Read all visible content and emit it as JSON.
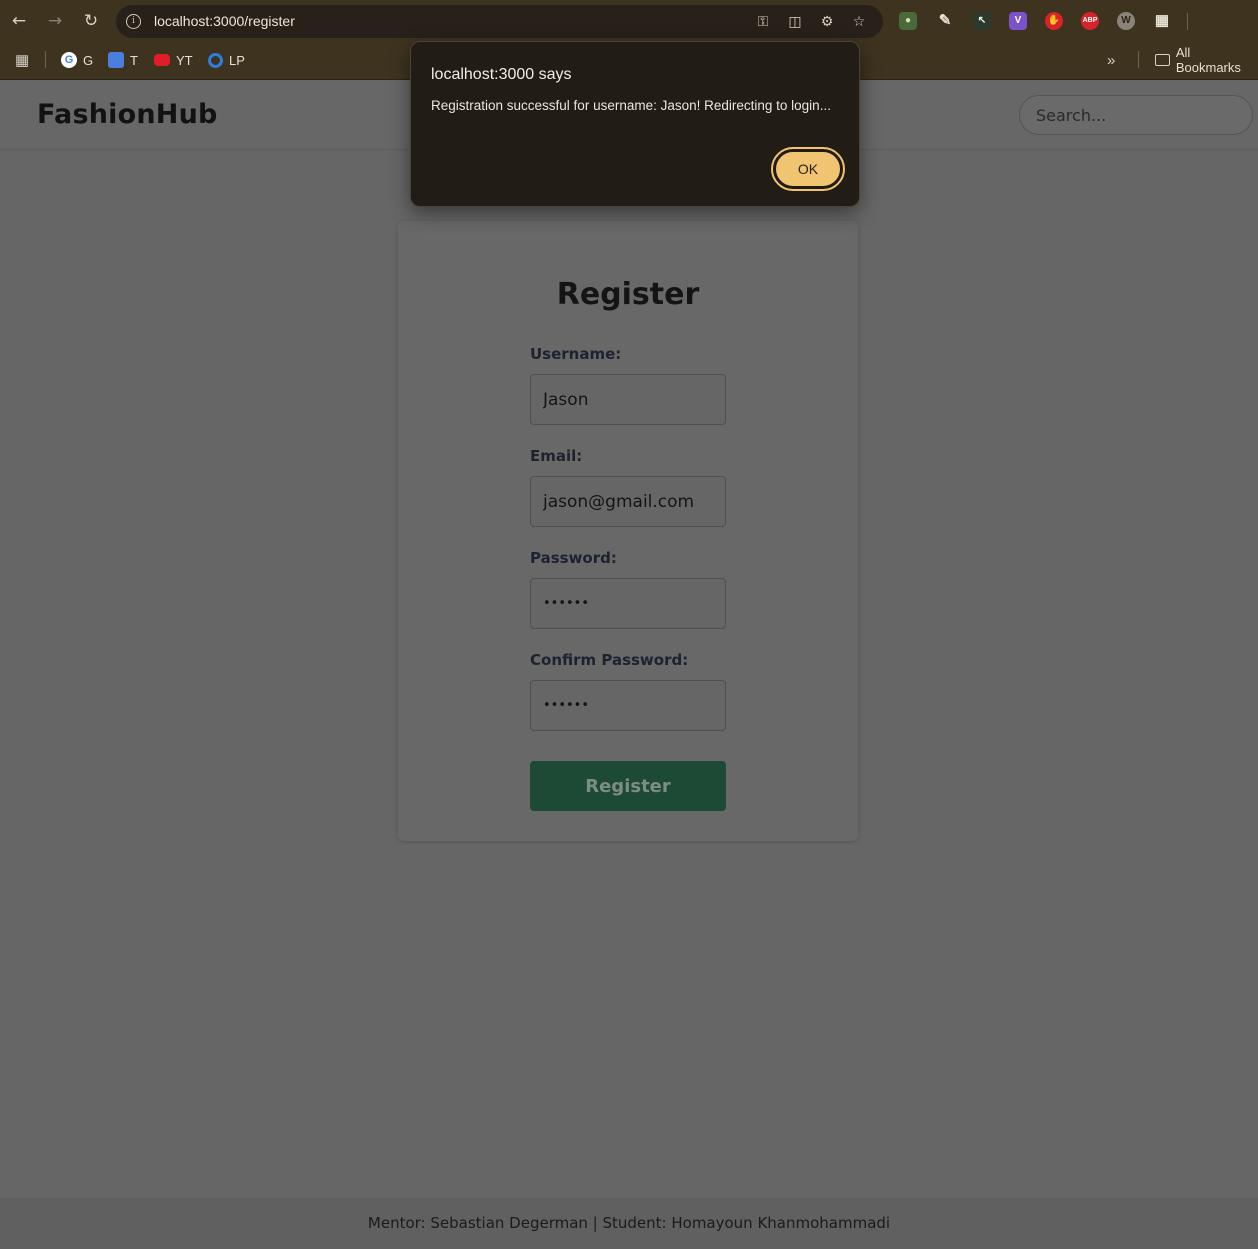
{
  "browser": {
    "url": "localhost:3000/register",
    "bookmarks": [
      {
        "label": "G",
        "icon": "google-icon"
      },
      {
        "label": "T",
        "icon": "translate-icon"
      },
      {
        "label": "YT",
        "icon": "youtube-icon"
      },
      {
        "label": "LP",
        "icon": "circle-icon"
      }
    ],
    "all_bookmarks_label": "All Bookmarks",
    "extensions": [
      {
        "icon": "node-js-icon",
        "label": ""
      },
      {
        "icon": "eyedropper-icon",
        "label": ""
      },
      {
        "icon": "cursor-icon",
        "label": ""
      },
      {
        "icon": "v-extension-icon",
        "label": "V"
      },
      {
        "icon": "hand-icon",
        "label": ""
      },
      {
        "icon": "adblock-icon",
        "label": "ABP"
      },
      {
        "icon": "w-extension-icon",
        "label": "W"
      },
      {
        "icon": "puzzle-icon",
        "label": ""
      }
    ]
  },
  "header": {
    "logo": "FashionHub",
    "search_placeholder": "Search..."
  },
  "form": {
    "title": "Register",
    "username_label": "Username:",
    "username_value": "Jason",
    "email_label": "Email:",
    "email_value": "jason@gmail.com",
    "password_label": "Password:",
    "password_value": "••••••",
    "confirm_label": "Confirm Password:",
    "confirm_value": "••••••",
    "submit_label": "Register"
  },
  "footer": {
    "text": "Mentor: Sebastian Degerman | Student: Homayoun Khanmohammadi"
  },
  "dialog": {
    "title": "localhost:3000 says",
    "message": "Registration successful for username: Jason! Redirecting to login...",
    "ok_label": "OK"
  },
  "colors": {
    "chrome": "#3e331f",
    "accent_button": "#f1c472",
    "register_button": "#1d4a34"
  }
}
